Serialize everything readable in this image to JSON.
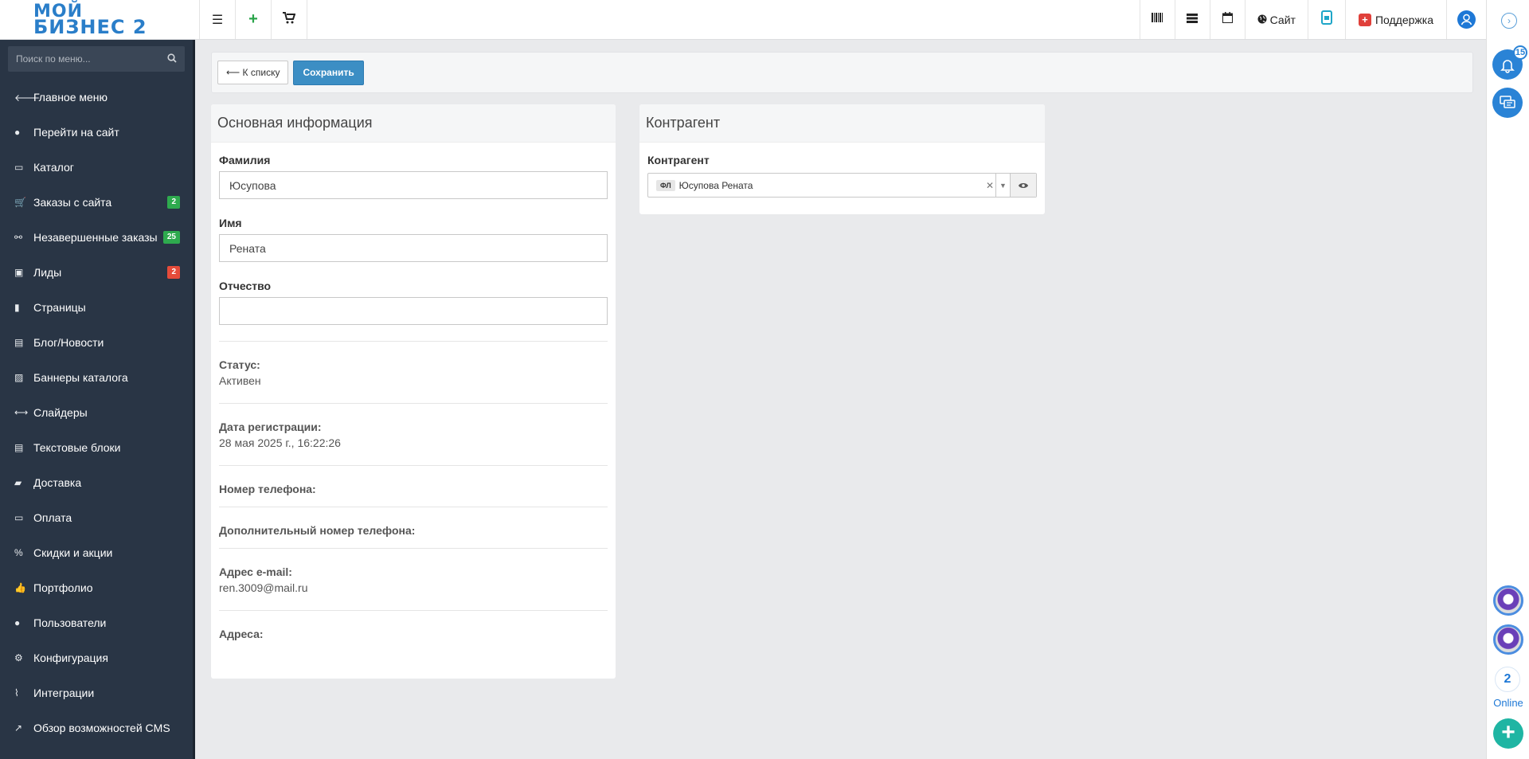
{
  "logo": {
    "line1": "МОЙ",
    "line2": "БИЗНЕС 2"
  },
  "topbar": {
    "site_label": "Сайт",
    "support_label": "Поддержка"
  },
  "sidebar": {
    "search_placeholder": "Поиск по меню...",
    "items": [
      {
        "label": "Главное меню",
        "icon": "arrow-left-icon",
        "glyph": "🡐"
      },
      {
        "label": "Перейти на сайт",
        "icon": "globe-icon",
        "glyph": "●"
      },
      {
        "label": "Каталог",
        "icon": "folder-icon",
        "glyph": "▭"
      },
      {
        "label": "Заказы с сайта",
        "icon": "cart-icon",
        "glyph": "🛒",
        "badge": "2",
        "badge_color": "#2eaa4e"
      },
      {
        "label": "Незавершенные заказы",
        "icon": "broken-link-icon",
        "glyph": "⚯",
        "badge": "25",
        "badge_color": "#2eaa4e"
      },
      {
        "label": "Лиды",
        "icon": "contact-card-icon",
        "glyph": "▣",
        "badge": "2",
        "badge_color": "#e54b3a"
      },
      {
        "label": "Страницы",
        "icon": "file-icon",
        "glyph": "▮"
      },
      {
        "label": "Блог/Новости",
        "icon": "newspaper-icon",
        "glyph": "▤"
      },
      {
        "label": "Баннеры каталога",
        "icon": "image-icon",
        "glyph": "▨"
      },
      {
        "label": "Слайдеры",
        "icon": "arrows-horizontal-icon",
        "glyph": "⟷"
      },
      {
        "label": "Текстовые блоки",
        "icon": "text-file-icon",
        "glyph": "▤"
      },
      {
        "label": "Доставка",
        "icon": "truck-icon",
        "glyph": "▰"
      },
      {
        "label": "Оплата",
        "icon": "credit-card-icon",
        "glyph": "▭"
      },
      {
        "label": "Скидки и акции",
        "icon": "percent-icon",
        "glyph": "%"
      },
      {
        "label": "Портфолио",
        "icon": "thumbs-up-icon",
        "glyph": "👍"
      },
      {
        "label": "Пользователи",
        "icon": "user-icon",
        "glyph": "●"
      },
      {
        "label": "Конфигурация",
        "icon": "gear-icon",
        "glyph": "⚙"
      },
      {
        "label": "Интеграции",
        "icon": "paperclip-icon",
        "glyph": "⌇"
      },
      {
        "label": "Обзор возможностей CMS",
        "icon": "line-chart-icon",
        "glyph": "↗"
      }
    ]
  },
  "toolbar": {
    "back_label": "⟵ К списку",
    "save_label": "Сохранить"
  },
  "main_panel": {
    "title": "Основная информация",
    "lastname_label": "Фамилия",
    "lastname_value": "Юсупова",
    "firstname_label": "Имя",
    "firstname_value": "Рената",
    "middlename_label": "Отчество",
    "middlename_value": "",
    "status_label": "Статус:",
    "status_value": "Активен",
    "regdate_label": "Дата регистрации:",
    "regdate_value": "28 мая 2025 г., 16:22:26",
    "phone_label": "Номер телефона:",
    "phone2_label": "Дополнительный номер телефона:",
    "email_label": "Адрес e-mail:",
    "email_value": "ren.3009@mail.ru",
    "address_label": "Адреса:"
  },
  "contragent_panel": {
    "title": "Контрагент",
    "field_label": "Контрагент",
    "tag": "ФЛ",
    "value": "Юсупова Рената"
  },
  "rail": {
    "notifications_count": "15",
    "online_count": "2",
    "online_label": "Online"
  },
  "colors": {
    "sidebar_bg": "#293545",
    "accent": "#2a83d6",
    "save_btn": "#3c8ec4",
    "badge_green": "#2eaa4e",
    "badge_red": "#e54b3a"
  }
}
